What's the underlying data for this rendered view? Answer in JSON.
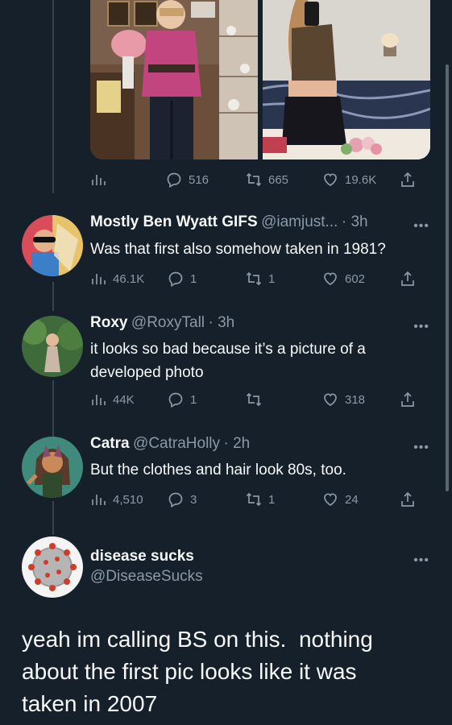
{
  "first_tweet_metrics": {
    "replies": "516",
    "retweets": "665",
    "likes": "19.6K"
  },
  "replies": [
    {
      "name": "Mostly Ben Wyatt GIFS",
      "handle": "@iamjust...",
      "time": "· 3h",
      "text": "Was that first also somehow taken in 1981?",
      "views": "46.1K",
      "replies": "1",
      "retweets": "1",
      "likes": "602"
    },
    {
      "name": "Roxy",
      "handle": "@RoxyTall",
      "time": "· 3h",
      "text_line1": "it looks so bad because it’s a picture of a",
      "text_line2": "developed photo",
      "views": "44K",
      "replies": "1",
      "retweets": "",
      "likes": "318"
    },
    {
      "name": "Catra",
      "handle": "@CatraHolly",
      "time": "· 2h",
      "text": "But the clothes and hair look 80s, too.",
      "views": "4,510",
      "replies": "3",
      "retweets": "1",
      "likes": "24"
    }
  ],
  "main_tweet": {
    "name": "disease sucks",
    "handle": "@DiseaseSucks",
    "text_line1": "yeah im calling BS on this.  nothing",
    "text_line2": "about the first pic looks like it was",
    "text_line3": "taken in 2007"
  },
  "more_glyph": "•••"
}
